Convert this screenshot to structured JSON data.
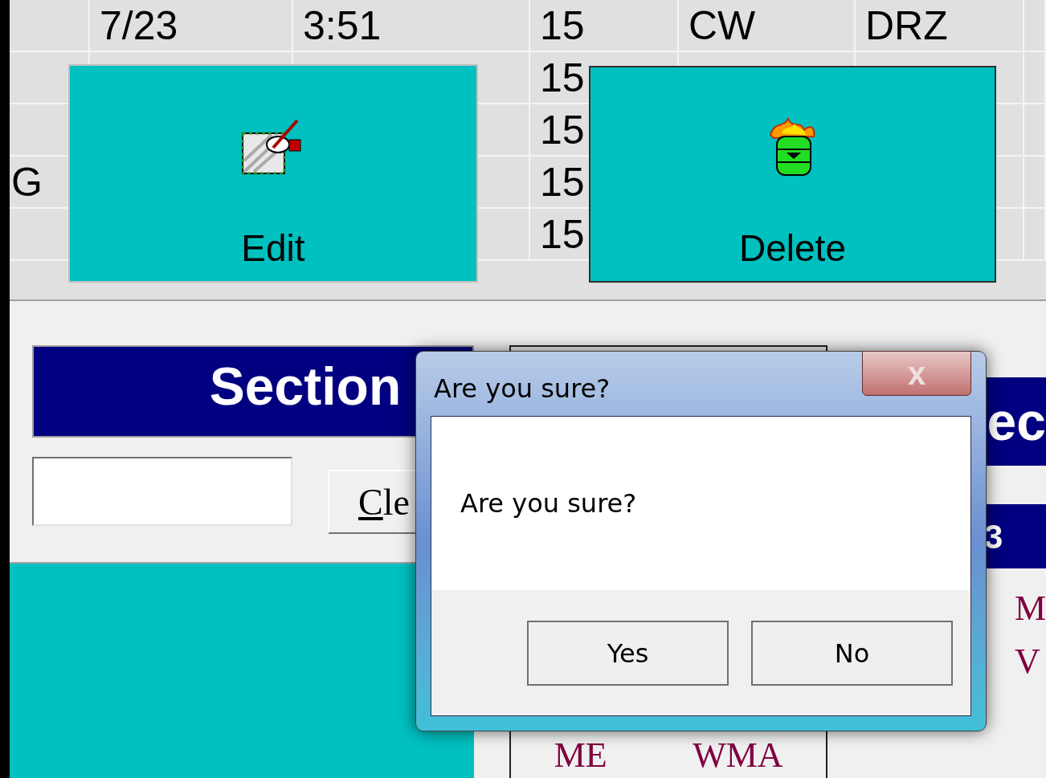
{
  "log_grid": {
    "rows": [
      {
        "column_1": "7/23",
        "column_2": "3:51",
        "column_3": "15",
        "column_4": "CW",
        "column_5": "DRZ"
      },
      {
        "column_3": "15"
      },
      {
        "column_3": "15"
      },
      {
        "column_0": "G",
        "column_3": "15"
      },
      {
        "column_3": "15"
      }
    ]
  },
  "action_buttons": [
    {
      "kind": "edit",
      "label": "Edit"
    },
    {
      "kind": "delete",
      "label": "Delete"
    }
  ],
  "section_panel": {
    "title": "Section",
    "clear_button": "Cle"
  },
  "middle_panel": {
    "cells": [
      "ME",
      "WMA"
    ]
  },
  "right_panel": {
    "header": "ec",
    "band": "3",
    "lines": [
      "M",
      "V"
    ]
  },
  "dialog": {
    "title": "Are you sure?",
    "close": "x",
    "message": "Are you sure?",
    "buttons": [
      "Yes",
      "No"
    ]
  }
}
